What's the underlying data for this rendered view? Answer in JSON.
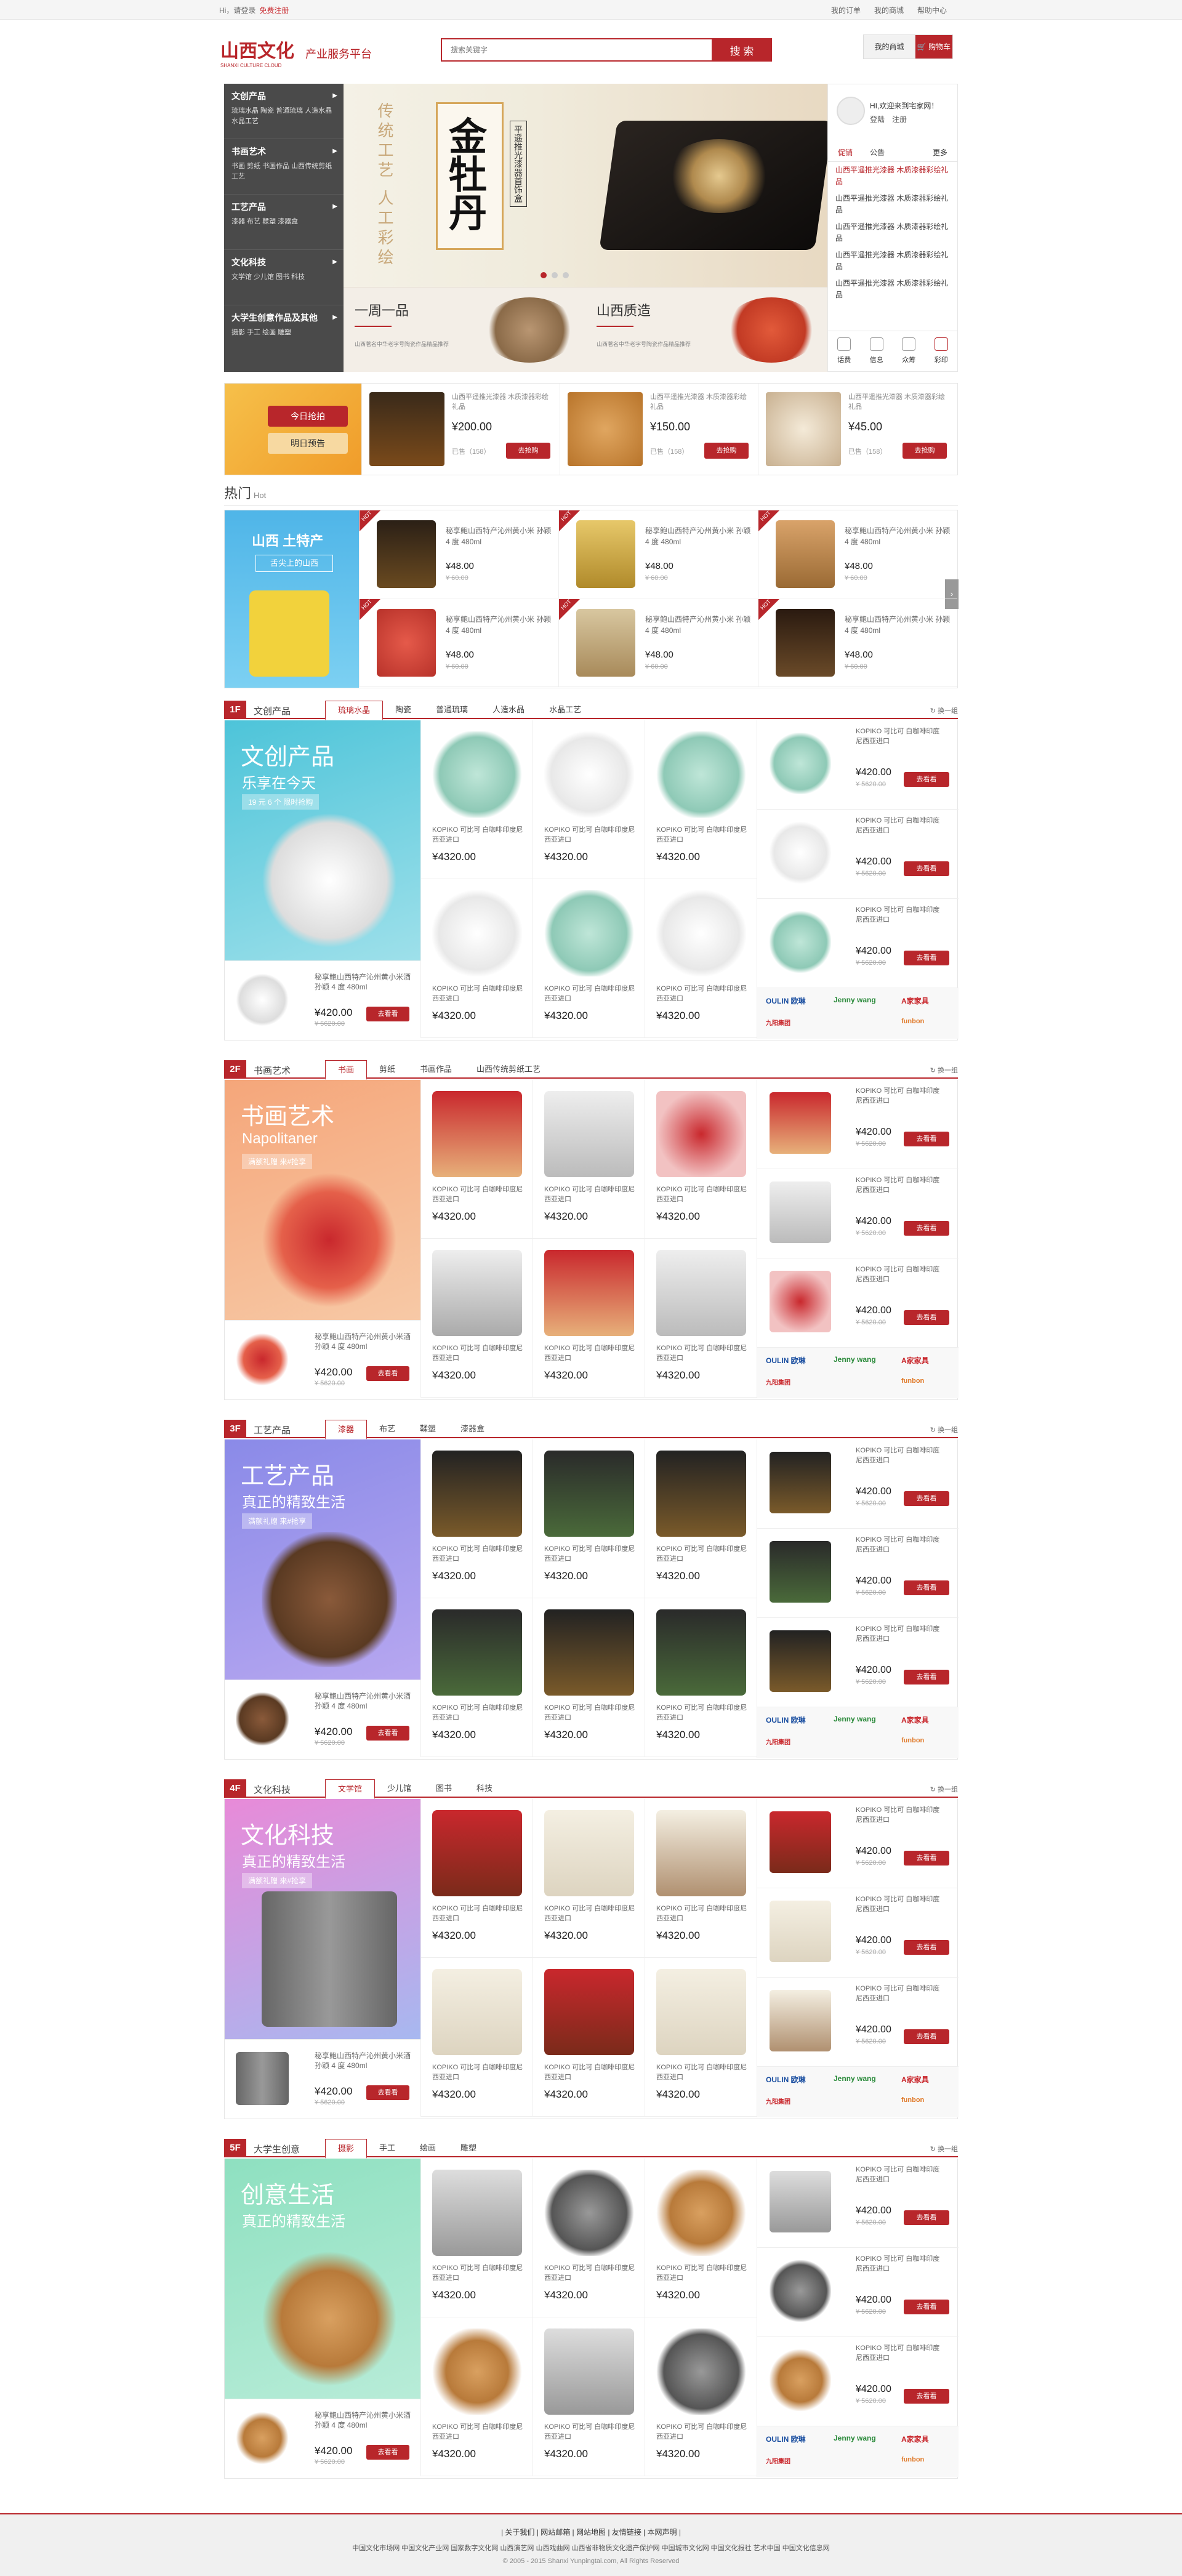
{
  "topbar": {
    "greeting": "Hi，请登录",
    "register": "免费注册",
    "links": [
      "我的订单",
      "我的商城",
      "帮助中心"
    ]
  },
  "logo": {
    "text": "山西文化",
    "subtitle": "SHANXI CULTURE CLOUD"
  },
  "platform": "产业服务平台",
  "search": {
    "placeholder": "搜索关键字",
    "button": "搜 索"
  },
  "mycart": {
    "my": "我的商城",
    "cart": "购物车"
  },
  "categories": [
    {
      "title": "文创产品",
      "sub": "琉璃水晶 陶瓷 普通琉璃 人造水晶 水晶工艺"
    },
    {
      "title": "书画艺术",
      "sub": "书画 剪纸 书画作品 山西传统剪纸工艺"
    },
    {
      "title": "工艺产品",
      "sub": "漆器 布艺 鞣塑 漆器盒"
    },
    {
      "title": "文化科技",
      "sub": "文学馆 少儿馆 图书 科技"
    },
    {
      "title": "大学生创意作品及其他",
      "sub": "摄影 手工 绘画 雕塑"
    }
  ],
  "banner": {
    "title": "金牡丹",
    "sub": "平遥推光漆器首饰盒",
    "vert": "传统工艺 人工彩绘"
  },
  "subbanners": [
    {
      "title": "一周一品",
      "desc": "山西著名中华老字号陶瓷作品精品推荐"
    },
    {
      "title": "山西质造",
      "desc": "山西著名中华老字号陶瓷作品精品推荐"
    }
  ],
  "side": {
    "hello": "HI,欢迎来到宅家网！",
    "login": "登陆",
    "reg": "注册",
    "tabs": [
      "促销",
      "公告"
    ],
    "more": "更多",
    "news": [
      "山西平遥推光漆器 木质漆器彩绘礼品",
      "山西平遥推光漆器 木质漆器彩绘礼品",
      "山西平遥推光漆器 木质漆器彩绘礼品",
      "山西平遥推光漆器 木质漆器彩绘礼品",
      "山西平遥推光漆器 木质漆器彩绘礼品"
    ],
    "icons": [
      "话费",
      "信息",
      "众筹",
      "彩印"
    ]
  },
  "strip": {
    "btn1": "今日抢拍",
    "btn2": "明日预告",
    "items": [
      {
        "name": "山西平遥推光漆器 木质漆器彩绘礼品",
        "price": "¥200.00",
        "sold": "已售（158）",
        "buy": "去抢购"
      },
      {
        "name": "山西平遥推光漆器 木质漆器彩绘礼品",
        "price": "¥150.00",
        "sold": "已售（158）",
        "buy": "去抢购"
      },
      {
        "name": "山西平遥推光漆器 木质漆器彩绘礼品",
        "price": "¥45.00",
        "sold": "已售（158）",
        "buy": "去抢购"
      }
    ]
  },
  "hot": {
    "title": "热门",
    "en": "Hot",
    "promo1": "山西 土特产",
    "promo2": "舌尖上的山西",
    "tag": "HOT",
    "items": [
      {
        "name": "秘享鲍山西特产沁州黄小米 孙颖 4 度 480ml",
        "price": "¥48.00",
        "old": "¥ 60.00"
      },
      {
        "name": "秘享鲍山西特产沁州黄小米 孙颖 4 度 480ml",
        "price": "¥48.00",
        "old": "¥ 60.00"
      },
      {
        "name": "秘享鲍山西特产沁州黄小米 孙颖 4 度 480ml",
        "price": "¥48.00",
        "old": "¥ 60.00"
      },
      {
        "name": "秘享鲍山西特产沁州黄小米 孙颖 4 度 480ml",
        "price": "¥48.00",
        "old": "¥ 60.00"
      },
      {
        "name": "秘享鲍山西特产沁州黄小米 孙颖 4 度 480ml",
        "price": "¥48.00",
        "old": "¥ 60.00"
      },
      {
        "name": "秘享鲍山西特产沁州黄小米 孙颖 4 度 480ml",
        "price": "¥48.00",
        "old": "¥ 60.00"
      }
    ]
  },
  "floors": [
    {
      "num": "1F",
      "name": "文创产品",
      "tabs": [
        "琉璃水晶",
        "陶瓷",
        "普通琉璃",
        "人造水晶",
        "水晶工艺"
      ],
      "refresh": "换一组",
      "promo1": "文创产品",
      "promo2": "乐享在今天",
      "ptag": "19 元 6 个 限时抢购"
    },
    {
      "num": "2F",
      "name": "书画艺术",
      "tabs": [
        "书画",
        "剪纸",
        "书画作品",
        "山西传统剪纸工艺"
      ],
      "refresh": "换一组",
      "promo1": "书画艺术",
      "promo2": "Napolitaner",
      "ptag": "满额礼赠 来#抢享"
    },
    {
      "num": "3F",
      "name": "工艺产品",
      "tabs": [
        "漆器",
        "布艺",
        "鞣塑",
        "漆器盒"
      ],
      "refresh": "换一组",
      "promo1": "工艺产品",
      "promo2": "真正的精致生活",
      "ptag": "满额礼赠 来#抢享"
    },
    {
      "num": "4F",
      "name": "文化科技",
      "tabs": [
        "文学馆",
        "少儿馆",
        "图书",
        "科技"
      ],
      "refresh": "换一组",
      "promo1": "文化科技",
      "promo2": "真正的精致生活",
      "ptag": "满额礼赠 来#抢享"
    },
    {
      "num": "5F",
      "name": "大学生创意",
      "tabs": [
        "摄影",
        "手工",
        "绘画",
        "雕塑"
      ],
      "refresh": "换一组",
      "promo1": "创意生活",
      "promo2": "真正的精致生活",
      "ptag": ""
    }
  ],
  "product": {
    "feat_name": "秘享鲍山西特产沁州黄小米酒 孙颖 4 度 480ml",
    "feat_price": "¥420.00",
    "feat_old": "¥ 5620.00",
    "go": "去看看",
    "grid_name": "KOPIKO 可比可 白咖啡印度尼西亚进口",
    "grid_price": "¥4320.00",
    "right_name": "KOPIKO 可比可 白咖啡印度尼西亚进口",
    "right_price": "¥420.00",
    "right_old": "¥ 5620.00"
  },
  "brands": {
    "a": "OULIN 欧琳",
    "b": "Jenny wang",
    "c": "A家家具",
    "d": "九阳集团",
    "e": "funbon"
  },
  "footer": {
    "links": "| 关于我们 | 网站邮箱 | 网站地图 | 友情链接 | 本网声明 |",
    "sites": "中国文化市场网  中国文化产业网  国家数字文化网  山西演艺网  山西戏曲网  山西省非物质文化遗产保护网  中国城市文化网  中国文化报社  艺术中国  中国文化信息网",
    "copy": "© 2005 - 2015 Shanxi Yunpingtai.com, All Rights Reserved"
  },
  "colors": {
    "brand": "#b8262b"
  }
}
